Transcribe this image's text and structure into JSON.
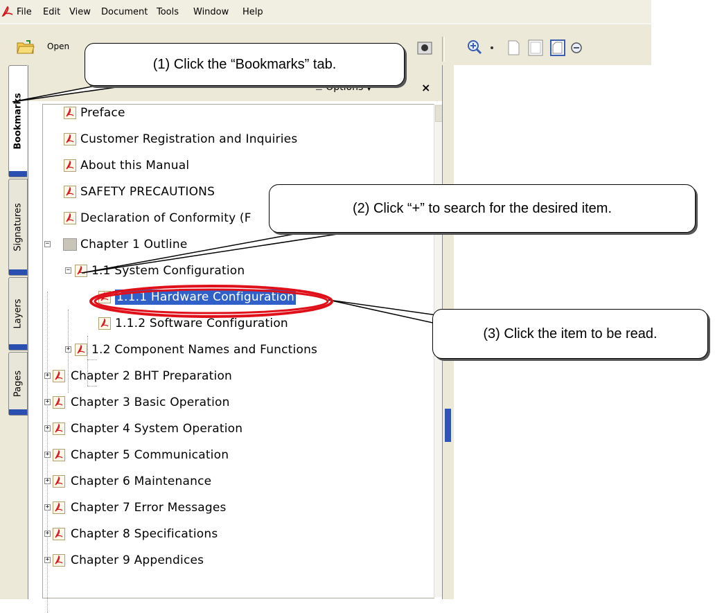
{
  "menu": {
    "items": [
      {
        "label": "File"
      },
      {
        "label": "Edit"
      },
      {
        "label": "View"
      },
      {
        "label": "Document"
      },
      {
        "label": "Tools"
      },
      {
        "label": "Window"
      },
      {
        "label": "Help"
      }
    ]
  },
  "toolbar": {
    "open_label": "Open"
  },
  "side_tabs": [
    {
      "label": "Bookmarks"
    },
    {
      "label": "Signatures"
    },
    {
      "label": "Layers"
    },
    {
      "label": "Pages"
    }
  ],
  "panel": {
    "options_label": "Options",
    "close_glyph": "×"
  },
  "bookmarks": [
    {
      "label": "Preface"
    },
    {
      "label": "Customer Registration and Inquiries"
    },
    {
      "label": "About this Manual"
    },
    {
      "label": "SAFETY PRECAUTIONS"
    },
    {
      "label": "Declaration of Conformity (F"
    },
    {
      "label": "Chapter 1 Outline"
    },
    {
      "label": "1.1 System Configuration"
    },
    {
      "label": "1.1.1 Hardware Configuration"
    },
    {
      "label": "1.1.2 Software Configuration"
    },
    {
      "label": "1.2 Component Names and Functions"
    },
    {
      "label": "Chapter 2 BHT Preparation"
    },
    {
      "label": "Chapter 3 Basic Operation"
    },
    {
      "label": "Chapter 4 System Operation"
    },
    {
      "label": "Chapter 5 Communication"
    },
    {
      "label": "Chapter 6 Maintenance"
    },
    {
      "label": "Chapter 7 Error Messages"
    },
    {
      "label": "Chapter 8 Specifications"
    },
    {
      "label": "Chapter 9 Appendices"
    }
  ],
  "callouts": {
    "step1": "(1) Click the “Bookmarks” tab.",
    "step2": "(2) Click “+” to search for the desired item.",
    "step3": "(3) Click the item to be read."
  },
  "colors": {
    "selection": "#2f61c8",
    "highlight_ring": "#e0101a",
    "chrome": "#ece9d8"
  }
}
